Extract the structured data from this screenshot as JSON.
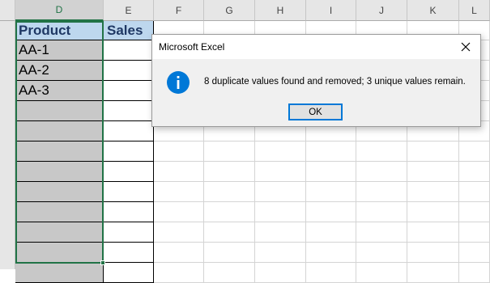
{
  "columns": [
    "D",
    "E",
    "F",
    "G",
    "H",
    "I",
    "J",
    "K",
    "L"
  ],
  "selected_column": "D",
  "table": {
    "headers": [
      "Product",
      "Sales"
    ],
    "products": [
      "AA-1",
      "AA-2",
      "AA-3"
    ]
  },
  "dialog": {
    "title": "Microsoft Excel",
    "message": "8 duplicate values found and removed; 3 unique values remain.",
    "ok_label": "OK",
    "icon": "info-icon"
  },
  "colors": {
    "header_fill": "#bdd7ee",
    "header_text": "#1f3864",
    "selection_fill": "#c8c8c8",
    "selection_border": "#217346",
    "info_icon": "#0078d7"
  }
}
